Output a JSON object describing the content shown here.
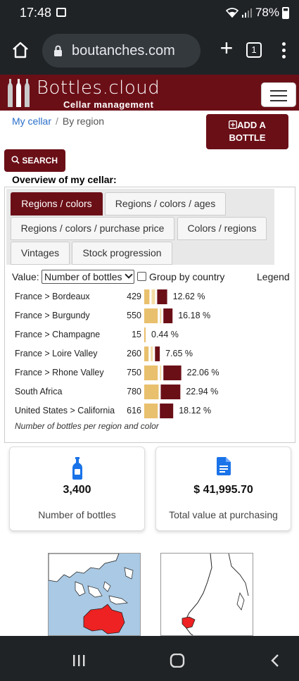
{
  "status": {
    "time": "17:48",
    "battery": "78%"
  },
  "browser": {
    "url": "boutanches.com",
    "tab_count": "1"
  },
  "site": {
    "name": "Bottles.cloud",
    "subtitle": "Cellar management"
  },
  "breadcrumb": {
    "home": "My cellar",
    "current": "By region"
  },
  "buttons": {
    "add_line1": "ADD A",
    "add_line2": "BOTTLE",
    "search": "SEARCH"
  },
  "overview_title": "Overview of my cellar:",
  "tabs": [
    {
      "label": "Regions / colors",
      "active": true
    },
    {
      "label": "Regions / colors / ages",
      "active": false
    },
    {
      "label": "Regions / colors / purchase price",
      "active": false
    },
    {
      "label": "Colors / regions",
      "active": false
    },
    {
      "label": "Vintages",
      "active": false
    },
    {
      "label": "Stock progression",
      "active": false
    }
  ],
  "controls": {
    "value_label": "Value:",
    "value_selected": "Number of bottles",
    "group_label": "Group by country",
    "group_checked": false,
    "legend_label": "Legend"
  },
  "chart_data": {
    "type": "bar",
    "categories": [
      "France > Bordeaux",
      "France > Burgundy",
      "France > Champagne",
      "France > Loire Valley",
      "France > Rhone Valley",
      "South Africa",
      "United States > California"
    ],
    "totals": [
      429,
      550,
      15,
      260,
      750,
      780,
      616
    ],
    "percentages": [
      "12.62 %",
      "16.18 %",
      "0.44 %",
      "7.65 %",
      "22.06 %",
      "22.94 %",
      "18.12 %"
    ],
    "series": [
      {
        "color": "#e9c06d",
        "values": [
          120,
          310,
          15,
          100,
          310,
          330,
          310
        ]
      },
      {
        "color": "#f4dca6",
        "values": [
          80,
          30,
          0,
          50,
          30,
          0,
          0
        ]
      },
      {
        "color": "#6b0f17",
        "values": [
          229,
          210,
          0,
          110,
          410,
          450,
          306
        ]
      }
    ],
    "caption": "Number of bottles per region and color"
  },
  "cards": [
    {
      "value": "3,400",
      "label": "Number of bottles",
      "icon": "wine-bottle-icon"
    },
    {
      "value": "$ 41,995.70",
      "label": "Total value at purchasing",
      "icon": "document-icon"
    }
  ],
  "colors": {
    "brand": "#6b0f17",
    "link": "#2a6fc9",
    "icon_blue": "#1a73e8"
  }
}
